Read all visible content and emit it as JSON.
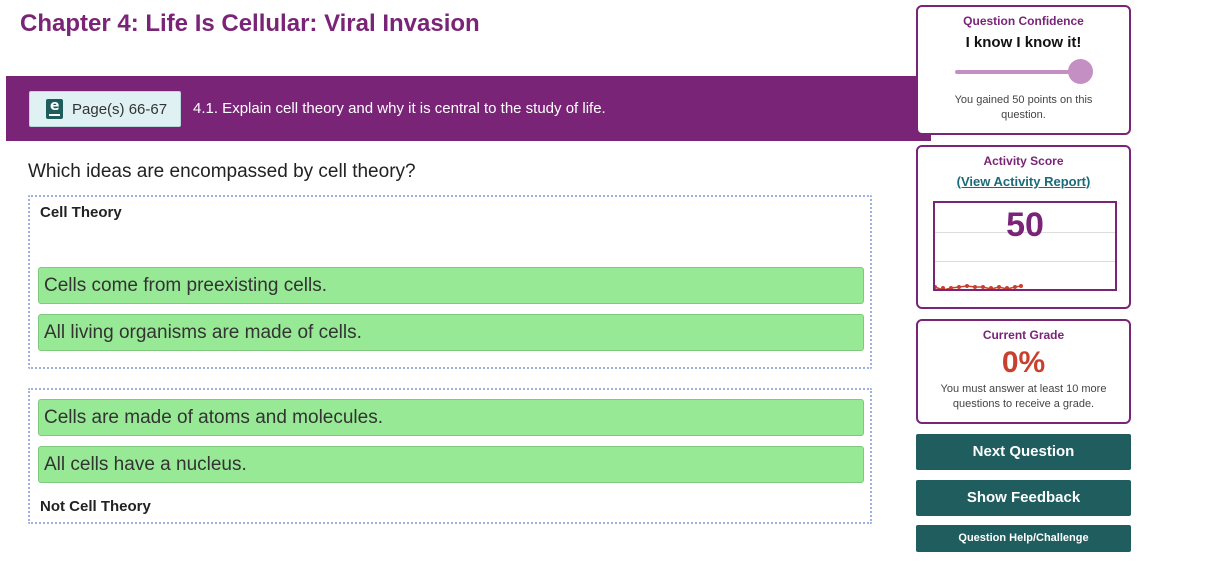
{
  "chapter": {
    "title": "Chapter 4: Life Is Cellular: Viral Invasion"
  },
  "objective": {
    "page_label": "Page(s) 66-67",
    "text": "4.1. Explain cell theory and why it is central to the study of life."
  },
  "question": {
    "text": "Which ideas are encompassed by cell theory?"
  },
  "zones": {
    "cell_theory": {
      "label": "Cell Theory",
      "items": [
        "Cells come from preexisting cells.",
        "All living organisms are made of cells."
      ]
    },
    "not_cell_theory": {
      "label": "Not Cell Theory",
      "items": [
        "Cells are made of atoms and molecules.",
        "All cells have a nucleus."
      ]
    }
  },
  "confidence": {
    "title": "Question Confidence",
    "value": "I know I know it!",
    "level": 1.0,
    "note": "You gained 50 points on this question."
  },
  "activity": {
    "title": "Activity Score",
    "link": "(View Activity Report)",
    "score": "50"
  },
  "grade": {
    "title": "Current Grade",
    "value": "0%",
    "note": "You must answer at least 10 more questions to receive a grade."
  },
  "buttons": {
    "next": "Next Question",
    "feedback": "Show Feedback",
    "help": "Question Help/Challenge"
  },
  "colors": {
    "brand": "#7a2478",
    "teal": "#1f5d5e",
    "tile": "#97e995",
    "grade": "#c8402e"
  }
}
